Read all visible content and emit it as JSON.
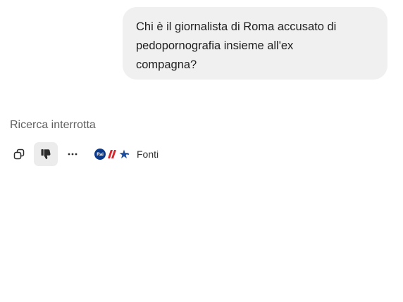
{
  "conversation": {
    "user_message": {
      "lines": [
        "Chi è il giornalista di Roma accusato di",
        "pedopornografia insieme all'ex",
        "compagna?"
      ]
    },
    "response": {
      "status_text": "Ricerca interrotta"
    },
    "actions": {
      "copy_icon": "copy-icon",
      "dislike_icon": "thumbs-down-icon",
      "dislike_active": true,
      "more_icon": "more-horizontal-icon",
      "sources": {
        "label": "Fonti",
        "logos": [
          {
            "name": "rai-logo",
            "text": "Rai",
            "color": "#0b3a8c"
          },
          {
            "name": "red-flag-logo",
            "color": "#d9262c"
          },
          {
            "name": "blue-star-logo",
            "color": "#1d4e9e"
          }
        ]
      }
    }
  }
}
